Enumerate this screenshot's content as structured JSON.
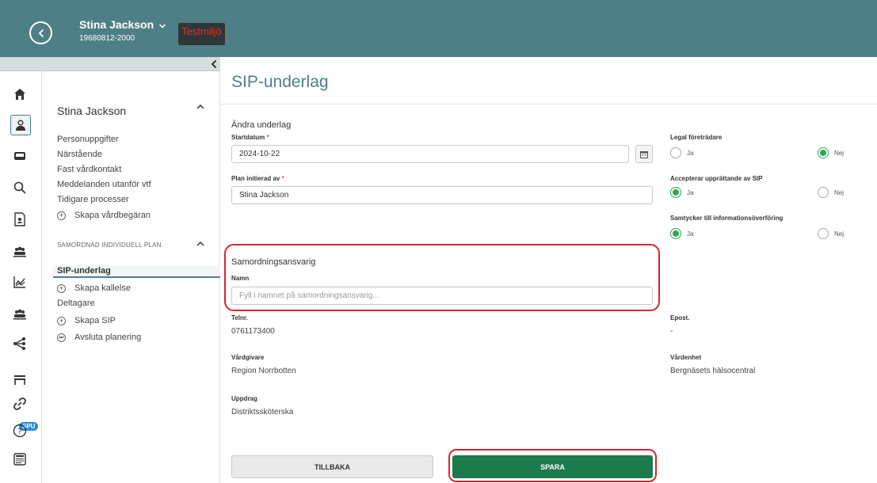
{
  "header": {
    "patient_name": "Stina Jackson",
    "patient_id": "19680812-2000",
    "env_badge": "Testmiljö"
  },
  "colors": {
    "header_bg": "#4e7f86",
    "accent": "#4e7f86",
    "save_button": "#1d7a4d",
    "radio_selected": "#2da55a",
    "highlight": "#d9262c",
    "env_badge_text": "#e0302f"
  },
  "rail": {
    "icons": [
      "home-icon",
      "person-icon",
      "inbox-icon",
      "search-icon",
      "document-person-icon",
      "group-icon",
      "chart-icon",
      "team-icon",
      "share-network-icon",
      "cart-icon",
      "link-icon",
      "help-icon",
      "news-icon"
    ],
    "spu_badge": "SPU"
  },
  "nav": {
    "title": "Stina Jackson",
    "links": [
      "Personuppgifter",
      "Närstående",
      "Fast vårdkontakt",
      "Meddelanden utanför vtf",
      "Tidigare processer"
    ],
    "create_care_request": "Skapa vårdbegäran",
    "section_label": "SAMORDNAD INDIVIDUELL PLAN",
    "active_item": "SIP-underlag",
    "create_invitation": "Skapa kallelse",
    "participants": "Deltagare",
    "create_sip": "Skapa SIP",
    "end_planning": "Avsluta planering"
  },
  "main": {
    "page_title": "SIP-underlag",
    "section_title": "Ändra underlag",
    "start_date_label": "Startdatum",
    "start_date_value": "2024-10-22",
    "required_mark": "*",
    "initiated_by_label": "Plan initierad av",
    "initiated_by_value": "Stina Jackson",
    "legal_rep_label": "Legal företrädare",
    "legal_rep_selected": "Nej",
    "accepts_sip_label": "Accepterar upprättande av SIP",
    "accepts_sip_selected": "Ja",
    "consent_label": "Samtycker till informationsöverföring",
    "consent_selected": "Ja",
    "radio_yes": "Ja",
    "radio_no": "Nej",
    "coordinator_title": "Samordningsansvarig",
    "name_label": "Namn",
    "name_placeholder": "Fyll i namnet på samordningsansvarig...",
    "phone_label": "Telnr.",
    "phone_value": "0761173400",
    "email_label": "Epost.",
    "email_value": "-",
    "caregiver_label": "Vårdgivare",
    "caregiver_value": "Region Norrbotten",
    "care_unit_label": "Vårdenhet",
    "care_unit_value": "Bergnäsets hälsocentral",
    "assignment_label": "Uppdrag",
    "assignment_value": "Distriktssköterska",
    "back_button": "TILLBAKA",
    "save_button": "SPARA"
  }
}
